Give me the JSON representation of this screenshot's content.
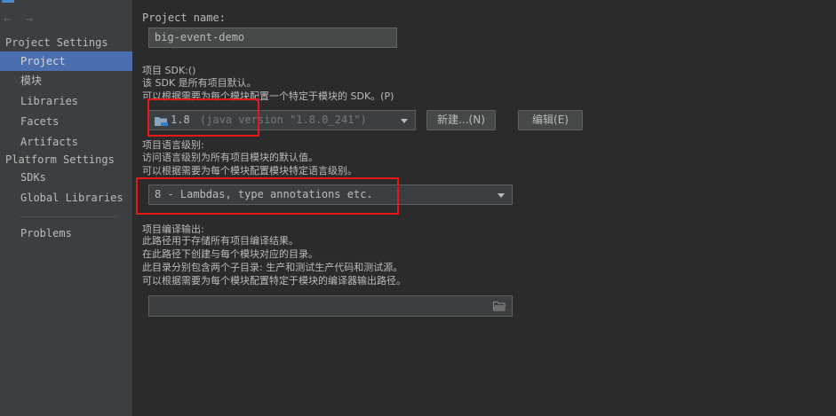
{
  "sidebar": {
    "nav_back": "←",
    "nav_forward": "→",
    "project_settings_header": "Project Settings",
    "project_settings_items": [
      "Project",
      "模块",
      "Libraries",
      "Facets",
      "Artifacts"
    ],
    "platform_settings_header": "Platform Settings",
    "platform_settings_items": [
      "SDKs",
      "Global Libraries"
    ],
    "problems": "Problems",
    "selected_item": "Project"
  },
  "main": {
    "project_name_label": "Project name:",
    "project_name_value": "big-event-demo",
    "sdk_label": "项目 SDK:()",
    "sdk_desc_1": "该 SDK 是所有项目默认。",
    "sdk_desc_2": "可以根据需要为每个模块配置一个特定于模块的 SDK。(P)",
    "sdk_selected": "1.8",
    "sdk_detail": "(java version \"1.8.0_241\")",
    "new_button": "新建...(N)",
    "edit_button": "编辑(E)",
    "lang_label": "项目语言级别:",
    "lang_desc_1": "访问语言级别为所有项目模块的默认值。",
    "lang_desc_2": "可以根据需要为每个模块配置模块特定语言级别。",
    "lang_selected": "8 - Lambdas, type annotations etc.",
    "output_label": "项目编译输出:",
    "output_desc_1": "此路径用于存储所有项目编译结果。",
    "output_desc_2": "在此路径下创建与每个模块对应的目录。",
    "output_desc_3": "此目录分别包含两个子目录: 生产和测试生产代码和测试源。",
    "output_desc_4": "可以根据需要为每个模块配置特定于模块的编译器输出路径。",
    "output_path_value": ""
  },
  "colors": {
    "highlight": "#e8161b",
    "selection": "#4b6eaf",
    "sidebar_bg": "#3c3f41",
    "main_bg": "#2b2b2b"
  }
}
